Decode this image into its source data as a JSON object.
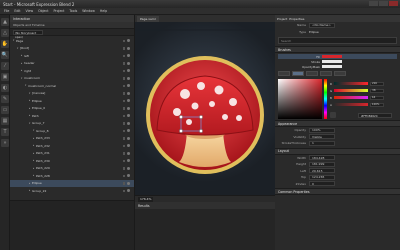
{
  "window": {
    "title": "Start - Microsoft Expression Blend 2"
  },
  "menu": [
    "File",
    "Edit",
    "View",
    "Object",
    "Project",
    "Tools",
    "Window",
    "Help"
  ],
  "tools": [
    "selection-tool-icon",
    "direct-select-tool-icon",
    "pan-tool-icon",
    "zoom-tool-icon",
    "eyedropper-tool-icon",
    "paint-bucket-tool-icon",
    "gradient-tool-icon",
    "pen-tool-icon",
    "rectangle-tool-icon",
    "grid-tool-icon",
    "text-tool-icon",
    "asset-library-icon"
  ],
  "interaction": {
    "title": "Interaction",
    "subtitle": "Objects and Timeline",
    "scene": "(No Storyboard open)",
    "tree": [
      {
        "indent": 0,
        "label": "Page",
        "expanded": true
      },
      {
        "indent": 1,
        "label": "[Root]",
        "expanded": true
      },
      {
        "indent": 2,
        "label": "left",
        "expanded": false
      },
      {
        "indent": 2,
        "label": "header",
        "expanded": false
      },
      {
        "indent": 2,
        "label": "right",
        "expanded": false
      },
      {
        "indent": 2,
        "label": "mushroom",
        "expanded": true
      },
      {
        "indent": 3,
        "label": "mushroom_normal",
        "expanded": true
      },
      {
        "indent": 4,
        "label": "[Canvas]",
        "expanded": true
      },
      {
        "indent": 4,
        "label": "Ellipse",
        "expanded": false
      },
      {
        "indent": 4,
        "label": "Ellipse_0",
        "expanded": false
      },
      {
        "indent": 4,
        "label": "Path",
        "expanded": false
      },
      {
        "indent": 4,
        "label": "Group_7",
        "expanded": true
      },
      {
        "indent": 5,
        "label": "Group_8",
        "expanded": true
      },
      {
        "indent": 5,
        "label": "Path_233",
        "expanded": false
      },
      {
        "indent": 5,
        "label": "Path_232",
        "expanded": false
      },
      {
        "indent": 5,
        "label": "Path_231",
        "expanded": false
      },
      {
        "indent": 5,
        "label": "Path_230",
        "expanded": false
      },
      {
        "indent": 5,
        "label": "Path_229",
        "expanded": false
      },
      {
        "indent": 5,
        "label": "Path_228",
        "expanded": false
      },
      {
        "indent": 4,
        "label": "Ellipse",
        "expanded": false
      },
      {
        "indent": 4,
        "label": "Group_22",
        "expanded": false
      }
    ],
    "selected_index": 19
  },
  "canvas": {
    "tab": "Page.xaml",
    "zoom": "176.4%",
    "results_title": "Results"
  },
  "artwork": {
    "border_color": "#d6b34a",
    "red": "#d8262c",
    "dark_red": "#9e1218",
    "stem": "#f3c98d",
    "stem_shadow": "#d7955b",
    "spots": "#f7e3e3"
  },
  "properties": {
    "tabs": [
      "Project",
      "Properties"
    ],
    "name_label": "Name",
    "name_value": "<No Name>",
    "type_label": "Type",
    "type_value": "Ellipse",
    "search_placeholder": "Search",
    "brushes_title": "Brushes",
    "brush_items": [
      {
        "label": "Fill"
      },
      {
        "label": "Stroke"
      },
      {
        "label": "OpacityMask"
      }
    ],
    "brush_values": [
      "",
      "No brush",
      "No brush"
    ],
    "channels": [
      {
        "label": "R",
        "value": "216"
      },
      {
        "label": "G",
        "value": "38"
      },
      {
        "label": "B",
        "value": "44"
      },
      {
        "label": "A",
        "value": "100%"
      }
    ],
    "hex": "#FFD8262C",
    "appearance_title": "Appearance",
    "opacity_label": "Opacity",
    "opacity_value": "100%",
    "visibility_label": "Visibility",
    "visibility_value": "Visible",
    "stroke_thickness_label": "StrokeThickness",
    "stroke_thickness_value": "1",
    "layout_title": "Layout",
    "width_label": "Width",
    "width_value": "184.428",
    "height_label": "Height",
    "height_value": "181.999",
    "left_label": "Left",
    "left_value": "29.615",
    "top_label": "Top",
    "top_value": "124.265",
    "zindex_label": "ZIndex",
    "zindex_value": "0",
    "common_title": "Common Properties"
  }
}
